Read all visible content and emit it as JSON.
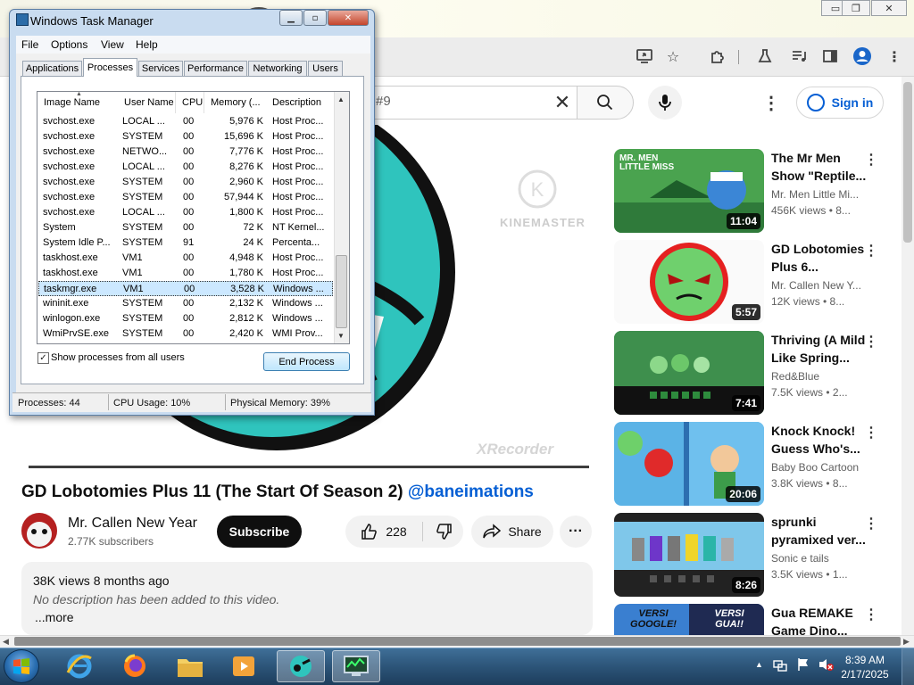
{
  "browser": {
    "window_controls": [
      "▭",
      "❐",
      "✕"
    ],
    "toolbar_icons": [
      "screen-cast-icon",
      "star-icon",
      "extensions-icon",
      "lab-flask-icon",
      "media-control-icon",
      "side-panel-icon",
      "profile-icon",
      "kebab-menu-icon"
    ]
  },
  "youtube": {
    "search_text": "#9",
    "sign_in": "Sign in",
    "video": {
      "title": "GD Lobotomies Plus 11 (The Start Of Season 2)",
      "title_link": "@baneimations",
      "watermark_top": "KINEMASTER",
      "watermark_bottom": "XRecorder"
    },
    "channel": {
      "name": "Mr. Callen New Year",
      "subscribers": "2.77K subscribers",
      "subscribe": "Subscribe"
    },
    "actions": {
      "likes": "228",
      "share": "Share"
    },
    "description": {
      "meta": "38K views  8 months ago",
      "text": "No description has been added to this video.",
      "more": "...more"
    },
    "recommendations": [
      {
        "title": "The Mr Men Show \"Reptile...",
        "channel": "Mr. Men Little Mi...",
        "views": "456K views  • 8...",
        "duration": "11:04",
        "thumb_text": "MR. MEN LITTLE MISS"
      },
      {
        "title": "GD Lobotomies Plus 6...",
        "channel": "Mr. Callen New Y...",
        "views": "12K views  • 8...",
        "duration": "5:57"
      },
      {
        "title": "Thriving (A Mild Like Spring...",
        "channel": "Red&Blue",
        "views": "7.5K views  • 2...",
        "duration": "7:41"
      },
      {
        "title": "Knock Knock! Guess Who's...",
        "channel": "Baby Boo Cartoon",
        "views": "3.8K views  • 8...",
        "duration": "20:06"
      },
      {
        "title": "sprunki pyramixed ver...",
        "channel": "Sonic e tails",
        "views": "3.5K views  • 1...",
        "duration": "8:26"
      },
      {
        "title": "Gua REMAKE Game Dino...",
        "channel": "",
        "views": "",
        "duration": "",
        "thumb_text_left": "VERSI GOOGLE!",
        "thumb_text_right": "VERSI GUA!!"
      }
    ]
  },
  "task_manager": {
    "title": "Windows Task Manager",
    "menu": [
      "File",
      "Options",
      "View",
      "Help"
    ],
    "tabs": [
      "Applications",
      "Processes",
      "Services",
      "Performance",
      "Networking",
      "Users"
    ],
    "selected_tab": "Processes",
    "columns": [
      "Image Name",
      "User Name",
      "CPU",
      "Memory (...",
      "Description"
    ],
    "rows": [
      [
        "svchost.exe",
        "LOCAL ...",
        "00",
        "5,976 K",
        "Host Proc..."
      ],
      [
        "svchost.exe",
        "SYSTEM",
        "00",
        "15,696 K",
        "Host Proc..."
      ],
      [
        "svchost.exe",
        "NETWO...",
        "00",
        "7,776 K",
        "Host Proc..."
      ],
      [
        "svchost.exe",
        "LOCAL ...",
        "00",
        "8,276 K",
        "Host Proc..."
      ],
      [
        "svchost.exe",
        "SYSTEM",
        "00",
        "2,960 K",
        "Host Proc..."
      ],
      [
        "svchost.exe",
        "SYSTEM",
        "00",
        "57,944 K",
        "Host Proc..."
      ],
      [
        "svchost.exe",
        "LOCAL ...",
        "00",
        "1,800 K",
        "Host Proc..."
      ],
      [
        "System",
        "SYSTEM",
        "00",
        "72 K",
        "NT Kernel..."
      ],
      [
        "System Idle P...",
        "SYSTEM",
        "91",
        "24 K",
        "Percenta..."
      ],
      [
        "taskhost.exe",
        "VM1",
        "00",
        "4,948 K",
        "Host Proc..."
      ],
      [
        "taskhost.exe",
        "VM1",
        "00",
        "1,780 K",
        "Host Proc..."
      ],
      [
        "taskmgr.exe",
        "VM1",
        "00",
        "3,528 K",
        "Windows ..."
      ],
      [
        "wininit.exe",
        "SYSTEM",
        "00",
        "2,132 K",
        "Windows ..."
      ],
      [
        "winlogon.exe",
        "SYSTEM",
        "00",
        "2,812 K",
        "Windows ..."
      ],
      [
        "WmiPrvSE.exe",
        "SYSTEM",
        "00",
        "2,420 K",
        "WMI Prov..."
      ]
    ],
    "selected_row": 11,
    "show_all_label": "Show processes from all users",
    "show_all_checked": true,
    "end_process": "End Process",
    "status": {
      "processes": "Processes: 44",
      "cpu": "CPU Usage: 10%",
      "memory": "Physical Memory: 39%"
    }
  },
  "taskbar": {
    "apps": [
      "internet-explorer-icon",
      "firefox-icon",
      "file-explorer-icon",
      "media-player-icon",
      "browser-app-icon",
      "task-manager-icon"
    ],
    "time": "8:39 AM",
    "date": "2/17/2025"
  }
}
